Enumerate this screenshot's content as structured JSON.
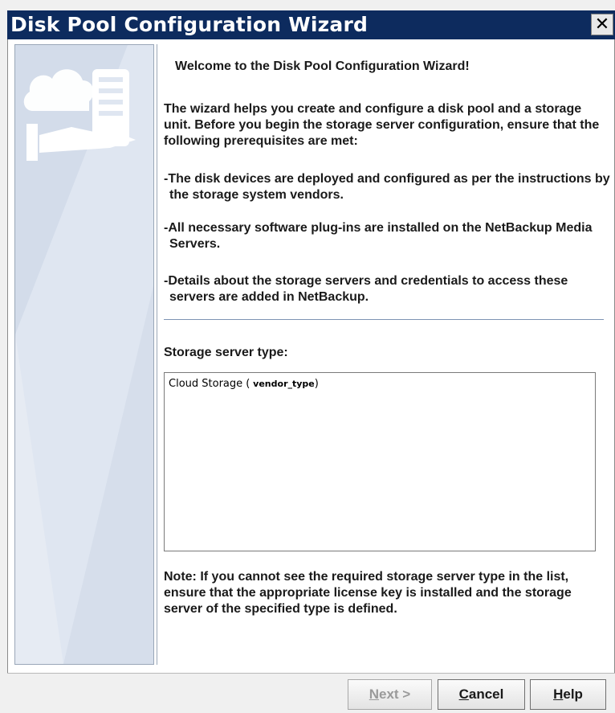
{
  "window": {
    "title": "Disk Pool Configuration Wizard",
    "close_glyph": "✕"
  },
  "side_panel": {
    "illustration": "cloud-server-hand-icon",
    "colors": {
      "panel_bg": "#dfe6f1",
      "shape": "#ffffff"
    }
  },
  "content": {
    "welcome": "Welcome to the Disk Pool Configuration Wizard!",
    "intro": "The wizard helps you create and configure a disk pool and a storage unit. Before you begin the storage server configuration, ensure that the following prerequisites are met:",
    "prereq_1": "-The disk devices are deployed and configured as per the instructions by the storage system vendors.",
    "prereq_2": "-All necessary software plug-ins are installed on the NetBackup Media Servers.",
    "prereq_3": "-Details about the storage servers and credentials to access these servers are added in NetBackup.",
    "server_type_label": "Storage server type:",
    "server_types": [
      {
        "name": "Cloud Storage (",
        "vendor": " vendor_type",
        "close": ")"
      }
    ],
    "note": "Note: If you cannot see the required storage server type in the list, ensure that the appropriate license key is installed and the storage server of the specified type is defined."
  },
  "buttons": {
    "next": {
      "mnemonic": "N",
      "rest": "ext >",
      "enabled": false
    },
    "cancel": {
      "mnemonic": "C",
      "rest": "ancel",
      "enabled": true
    },
    "help": {
      "mnemonic": "H",
      "rest": "elp",
      "enabled": true
    }
  },
  "colors": {
    "titlebar": "#0d2b5e",
    "title_text": "#ffffff",
    "divider": "#7d93b4"
  }
}
